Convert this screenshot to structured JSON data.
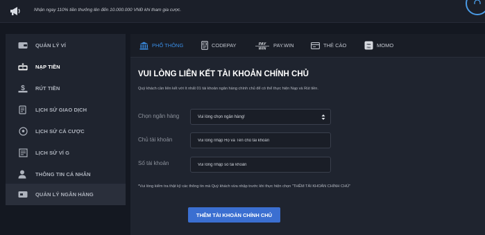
{
  "banner": {
    "promo_text": "Nhận ngay 110% tiền thưởng lên đến 10.000.000 VNĐ khi tham gia cược.",
    "icon": "megaphone-icon"
  },
  "sidebar": {
    "items": [
      {
        "label": "QUẢN LÝ VÍ",
        "icon": "wallet-icon",
        "active": false
      },
      {
        "label": "NẠP TIỀN",
        "icon": "deposit-icon",
        "active": true
      },
      {
        "label": "RÚT TIỀN",
        "icon": "withdraw-icon",
        "active": false
      },
      {
        "label": "LỊCH SỬ GIAO DỊCH",
        "icon": "transaction-history-icon",
        "active": false
      },
      {
        "label": "LỊCH SỬ CÁ CƯỢC",
        "icon": "soccer-ball-icon",
        "active": false
      },
      {
        "label": "LỊCH SỬ VÍ G",
        "icon": "wallet-history-icon",
        "active": false
      },
      {
        "label": "THÔNG TIN CÁ NHÂN",
        "icon": "user-icon",
        "active": false
      },
      {
        "label": "QUẢN LÝ NGÂN HÀNG",
        "icon": "bank-card-icon",
        "active": false
      }
    ]
  },
  "tabs": [
    {
      "label": "PHỔ THÔNG",
      "icon": "bank-building-icon",
      "active": true
    },
    {
      "label": "CODEPAY",
      "icon": "code-card-icon",
      "active": false
    },
    {
      "label": "PAY.WIN",
      "icon": "paywin-logo-icon",
      "logo_text": "PAY WIN",
      "active": false
    },
    {
      "label": "THẺ CÀO",
      "icon": "scratch-card-icon",
      "active": false
    },
    {
      "label": "MOMO",
      "icon": "momo-logo-icon",
      "logo_text": "mo mo",
      "active": false
    }
  ],
  "form": {
    "title": "VUI LÒNG LIÊN KẾT TÀI KHOẢN CHÍNH CHỦ",
    "description": "Quý khách cần liên kết với ít nhất 01 tài khoản ngân hàng chính chủ để có thể thực hiện Nạp và Rút tiền.",
    "bank_label": "Chọn ngân hàng",
    "bank_selected": "Vui lòng chọn ngân hàng!",
    "holder_label": "Chủ tài khoản",
    "holder_placeholder": "Vui lòng nhập Họ và Tên chủ tài khoản",
    "account_label": "Số tài khoản",
    "account_placeholder": "Vui lòng nhập số tài khoản",
    "note": "*Vui lòng kiểm tra thật kỹ các thông tin mà Quý khách vừa nhập trước khi thực hiện chọn \"THÊM TÀI KHOẢN CHÍNH CHỦ\"",
    "submit_label": "THÊM TÀI KHOẢN CHÍNH CHỦ"
  },
  "colors": {
    "background": "#141821",
    "panel": "#1f242f",
    "accent": "#3a8ee6",
    "button": "#3b6fd1"
  }
}
